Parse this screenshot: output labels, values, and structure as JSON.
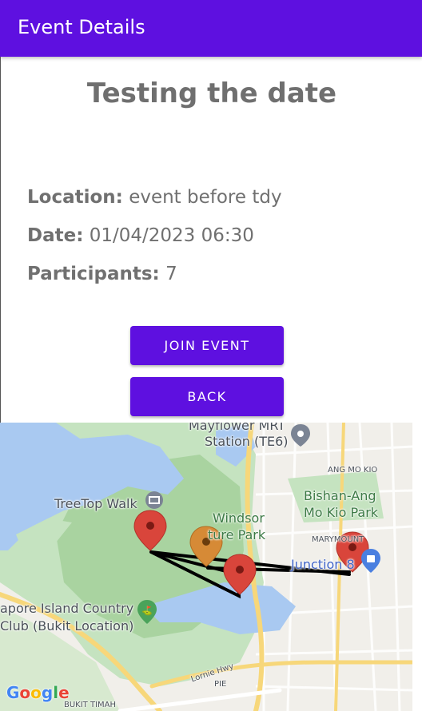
{
  "app_bar": {
    "title": "Event Details"
  },
  "event": {
    "title": "Testing the date",
    "location_label": "Location:",
    "location_value": "event before tdy",
    "date_label": "Date:",
    "date_value": "01/04/2023 06:30",
    "participants_label": "Participants:",
    "participants_value": "7"
  },
  "buttons": {
    "join": "JOIN EVENT",
    "back": "BACK"
  },
  "map": {
    "labels": {
      "mayflower": "Mayflower MRT",
      "station": "Station (TE6)",
      "ang_mo_kio": "ANG MO KIO",
      "bishan_1": "Bishan-Ang",
      "bishan_2": "Mo Kio Park",
      "treetop": "TreeTop Walk",
      "windsor_1": "Windsor",
      "windsor_2": "ture Park",
      "marymount": "MARYMOUNT",
      "junction": "Junction 8",
      "island_1": "apore Island Country",
      "island_2": "Club (Bukit Location)",
      "lornie": "Lornie Hwy",
      "pie": "PIE",
      "bukit_timah": "BUKIT TIMAH"
    },
    "logo": "Google",
    "colors": {
      "marker_red": "#d9453b",
      "marker_orange": "#d68a36",
      "route": "#000000"
    }
  }
}
